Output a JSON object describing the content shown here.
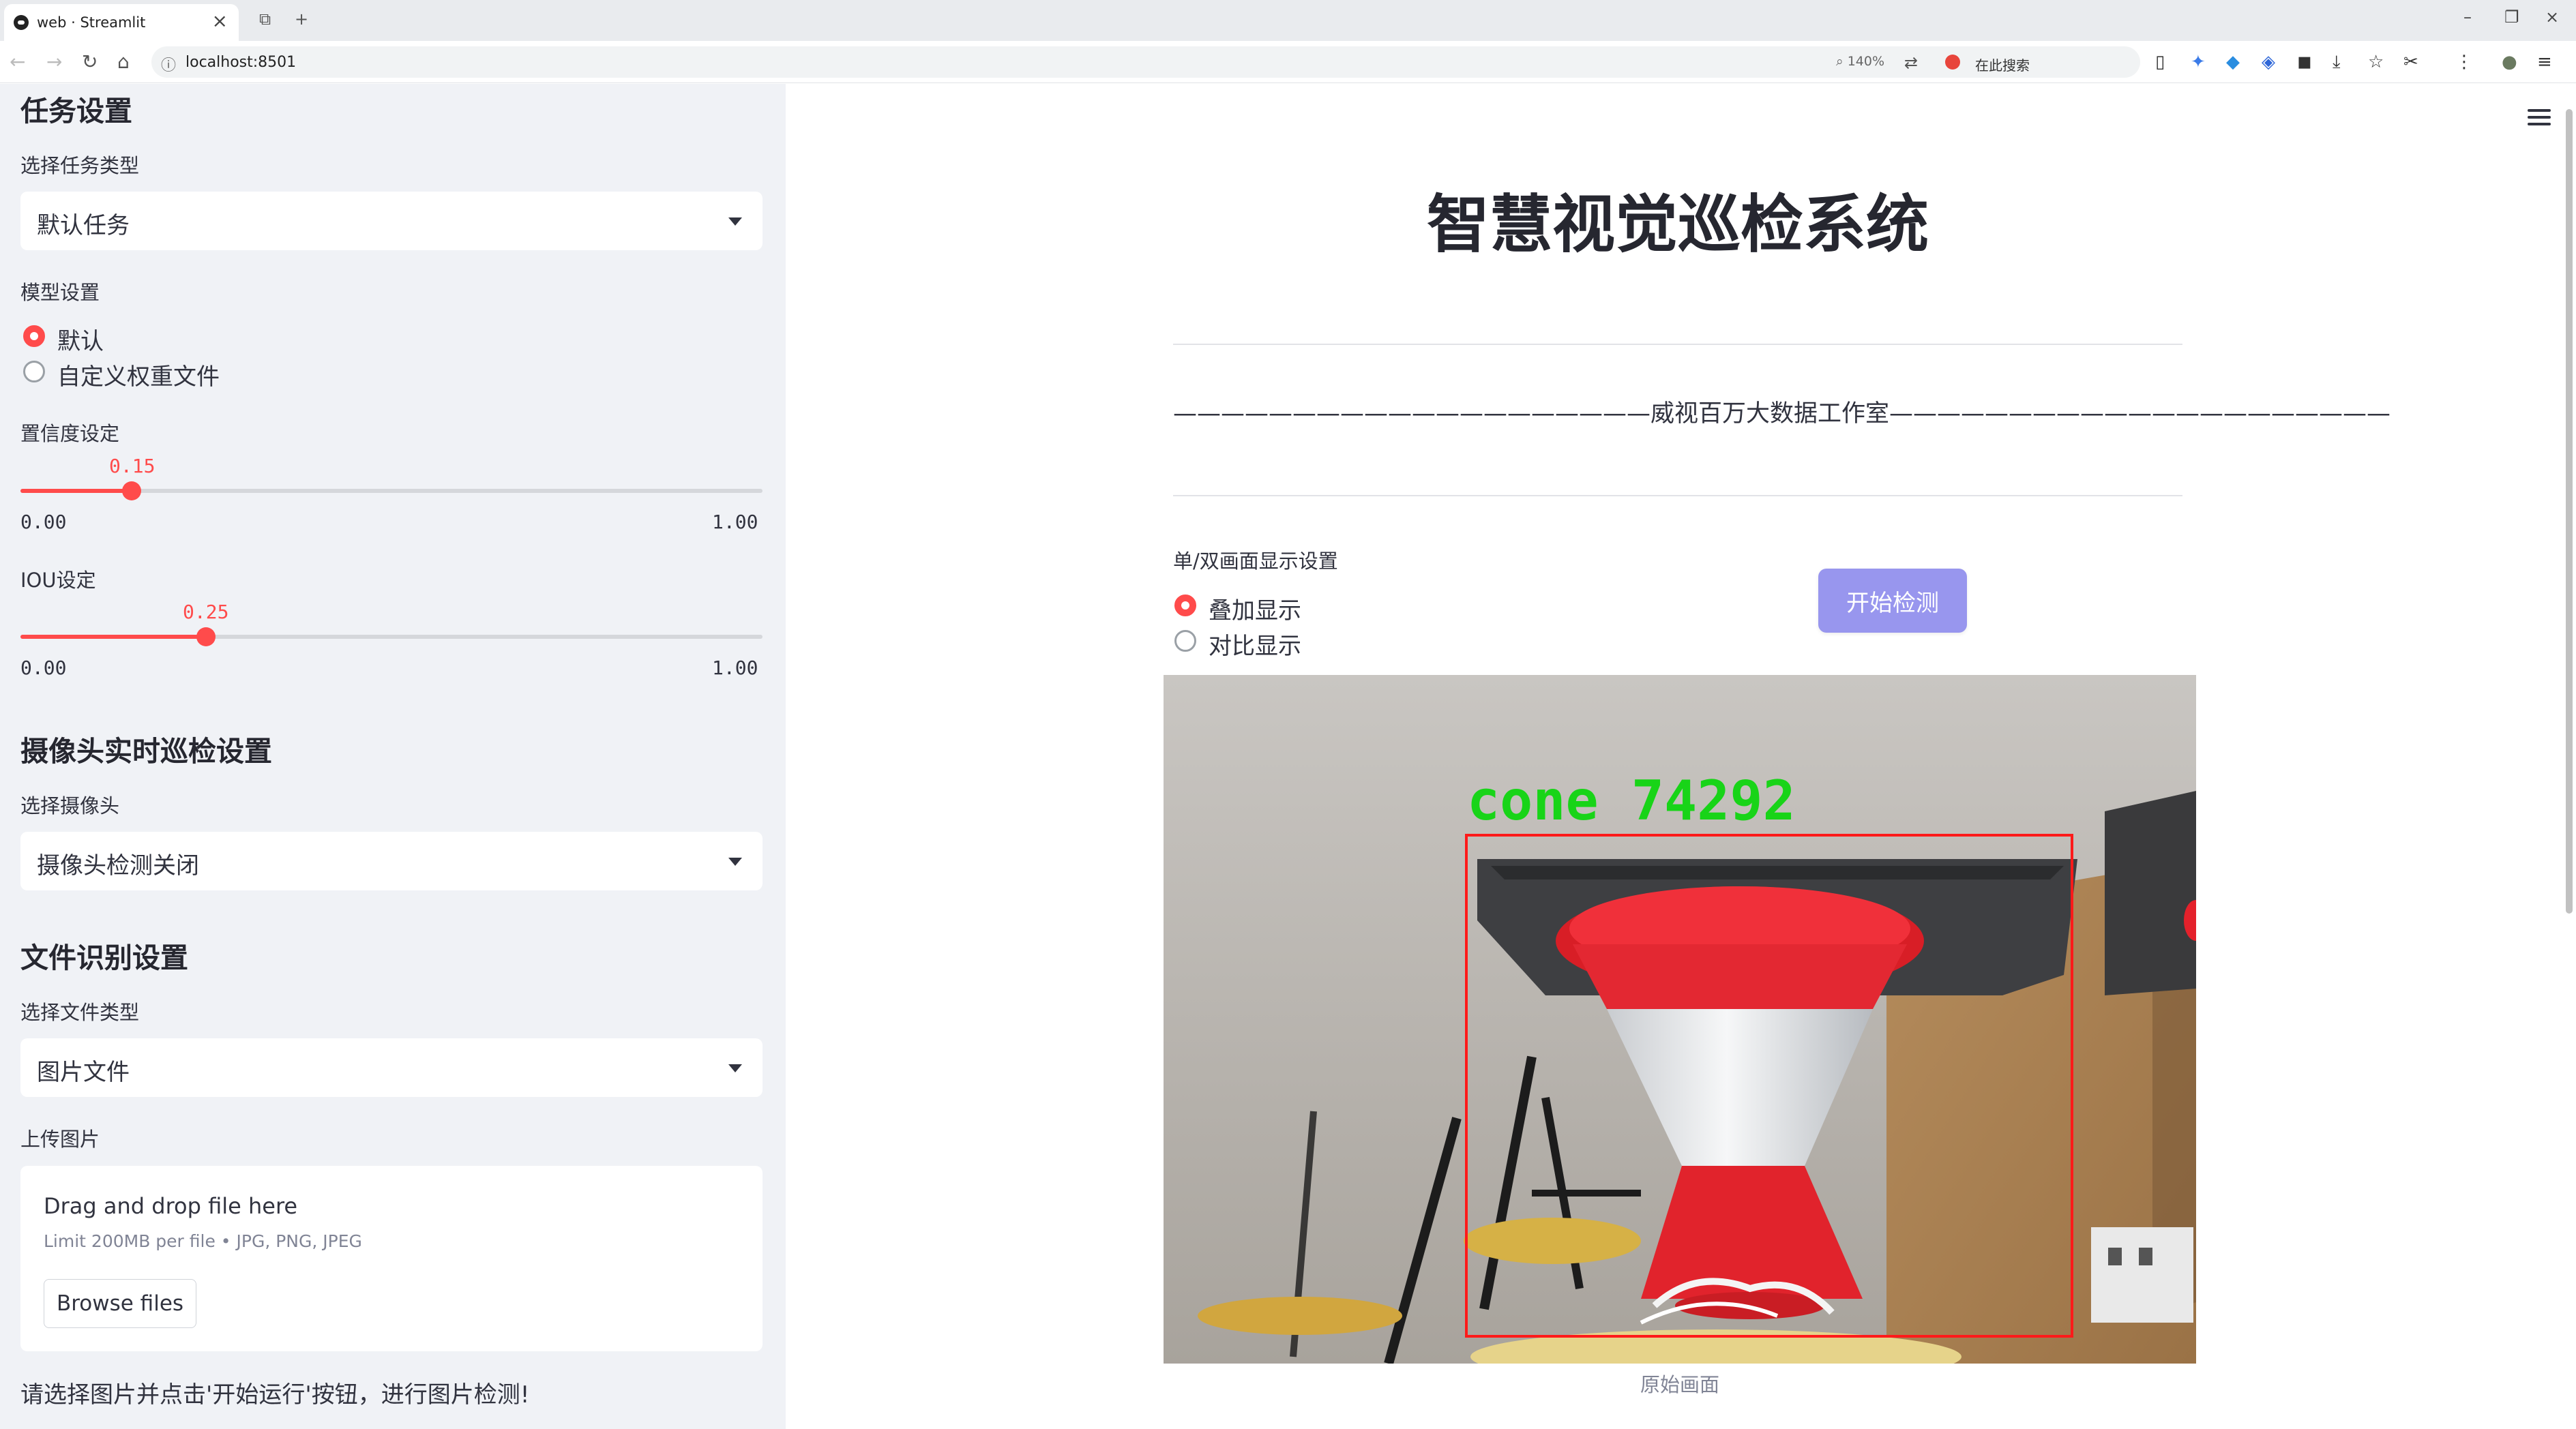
{
  "browser": {
    "tab_title": "web · Streamlit",
    "url": "localhost:8501",
    "zoom": "140%",
    "search_placeholder": "在此搜索"
  },
  "sidebar": {
    "task_section_title": "任务设置",
    "task_type_label": "选择任务类型",
    "task_type_value": "默认任务",
    "model_label": "模型设置",
    "model_options": [
      {
        "label": "默认",
        "selected": true
      },
      {
        "label": "自定义权重文件",
        "selected": false
      }
    ],
    "confidence": {
      "label": "置信度设定",
      "value": "0.15",
      "fraction": 0.15,
      "min": "0.00",
      "max": "1.00"
    },
    "iou": {
      "label": "IOU设定",
      "value": "0.25",
      "fraction": 0.25,
      "min": "0.00",
      "max": "1.00"
    },
    "camera_section_title": "摄像头实时巡检设置",
    "camera_label": "选择摄像头",
    "camera_value": "摄像头检测关闭",
    "file_section_title": "文件识别设置",
    "file_type_label": "选择文件类型",
    "file_type_value": "图片文件",
    "upload_label": "上传图片",
    "uploader": {
      "drag_text": "Drag and drop file here",
      "limit_text": "Limit 200MB per file • JPG, PNG, JPEG",
      "browse_label": "Browse files"
    },
    "hint": "请选择图片并点击'开始运行'按钮，进行图片检测!"
  },
  "main": {
    "title": "智慧视觉巡检系统",
    "subtitle": "————————————————————威视百万大数据工作室—————————————————————",
    "display_label": "单/双画面显示设置",
    "display_options": [
      {
        "label": "叠加显示",
        "selected": true
      },
      {
        "label": "对比显示",
        "selected": false
      }
    ],
    "start_button": "开始检测",
    "detection_label": "cone 74292",
    "caption": "原始画面"
  },
  "colors": {
    "accent": "#ff4b4b",
    "sidebar_bg": "#f0f2f6",
    "button_bg": "#9896ee",
    "detection_box": "#ff1a1a",
    "detection_text": "#18d418"
  }
}
